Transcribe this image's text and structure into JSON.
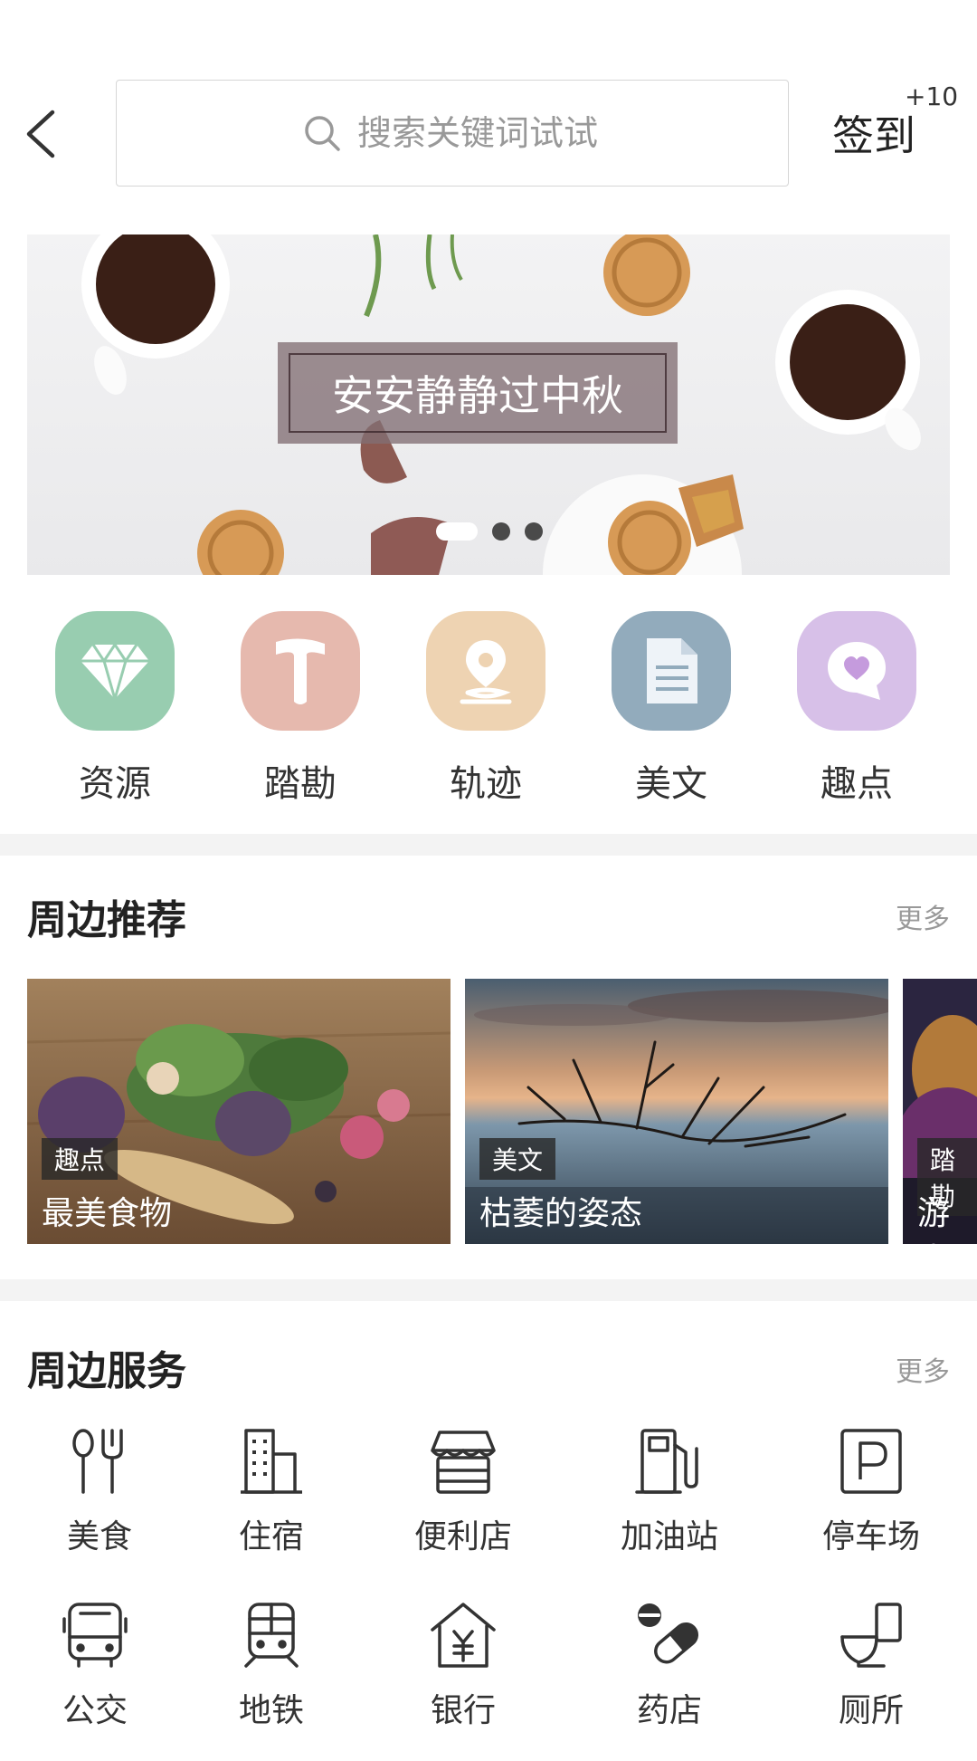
{
  "header": {
    "search_placeholder": "搜索关键词试试",
    "checkin_label": "签到",
    "checkin_bonus": "+10"
  },
  "banner": {
    "title": "安安静静过中秋",
    "active_slide": 1,
    "slide_count": 3
  },
  "categories": [
    {
      "label": "资源",
      "icon": "diamond-icon",
      "color": "#98cdb0"
    },
    {
      "label": "踏勘",
      "icon": "hammer-icon",
      "color": "#e6b9ae"
    },
    {
      "label": "轨迹",
      "icon": "location-pin-icon",
      "color": "#eed3b2"
    },
    {
      "label": "美文",
      "icon": "document-icon",
      "color": "#92abbc"
    },
    {
      "label": "趣点",
      "icon": "heart-chat-icon",
      "color": "#d7c0e8"
    }
  ],
  "nearby_recommend": {
    "title": "周边推荐",
    "more": "更多",
    "cards": [
      {
        "tag": "趣点",
        "title": "最美食物"
      },
      {
        "tag": "美文",
        "title": "枯萎的姿态"
      },
      {
        "tag": "踏勘",
        "title": "游走"
      }
    ]
  },
  "nearby_services": {
    "title": "周边服务",
    "more": "更多",
    "items": [
      {
        "label": "美食",
        "icon": "fork-spoon-icon"
      },
      {
        "label": "住宿",
        "icon": "building-icon"
      },
      {
        "label": "便利店",
        "icon": "store-icon"
      },
      {
        "label": "加油站",
        "icon": "gas-pump-icon"
      },
      {
        "label": "停车场",
        "icon": "parking-icon"
      },
      {
        "label": "公交",
        "icon": "bus-icon"
      },
      {
        "label": "地铁",
        "icon": "subway-icon"
      },
      {
        "label": "银行",
        "icon": "bank-icon"
      },
      {
        "label": "药店",
        "icon": "pill-icon"
      },
      {
        "label": "厕所",
        "icon": "toilet-icon"
      }
    ]
  }
}
